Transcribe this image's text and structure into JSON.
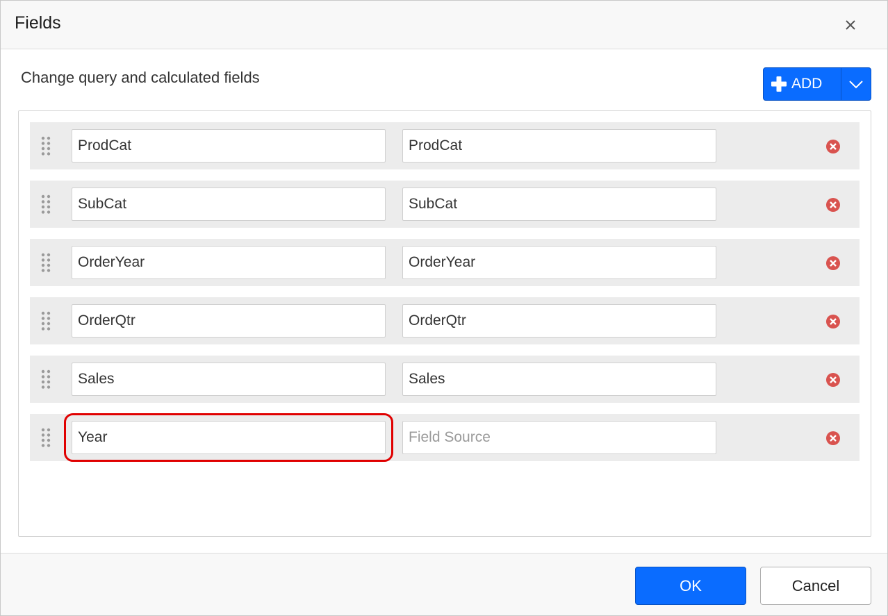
{
  "dialog": {
    "title": "Fields",
    "subtitle": "Change query and calculated fields"
  },
  "toolbar": {
    "add_label": "ADD"
  },
  "fields": [
    {
      "name": "ProdCat",
      "source": "ProdCat"
    },
    {
      "name": "SubCat",
      "source": "SubCat"
    },
    {
      "name": "OrderYear",
      "source": "OrderYear"
    },
    {
      "name": "OrderQtr",
      "source": "OrderQtr"
    },
    {
      "name": "Sales",
      "source": "Sales"
    },
    {
      "name": "Year",
      "source": "",
      "source_placeholder": "Field Source"
    }
  ],
  "footer": {
    "ok_label": "OK",
    "cancel_label": "Cancel"
  },
  "colors": {
    "primary": "#0a6cff",
    "remove": "#d9534f",
    "highlight": "#e00000",
    "row_bg": "#ececec"
  },
  "icons": {
    "close": "close-icon",
    "add": "plus-icon",
    "dropdown": "chevron-down-icon",
    "drag": "drag-handle-icon",
    "remove": "remove-circle-icon"
  }
}
